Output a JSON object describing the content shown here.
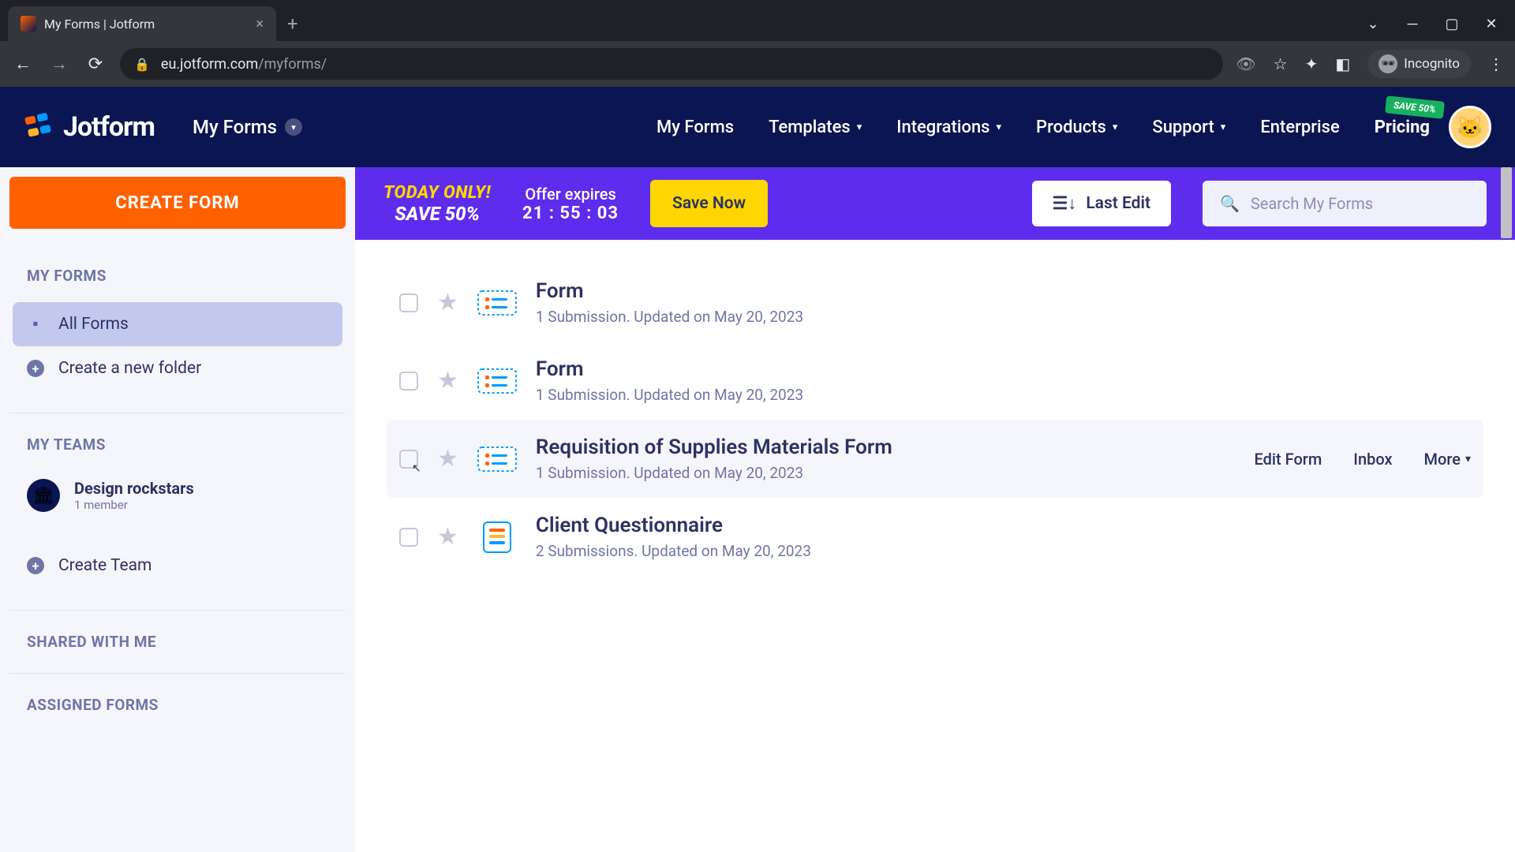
{
  "browser": {
    "tab_title": "My Forms | Jotform",
    "url_host": "eu.jotform.com",
    "url_path": "/myforms/",
    "incognito_label": "Incognito"
  },
  "header": {
    "logo_text": "Jotform",
    "dropdown_label": "My Forms",
    "nav": [
      {
        "label": "My Forms",
        "has_chev": false
      },
      {
        "label": "Templates",
        "has_chev": true
      },
      {
        "label": "Integrations",
        "has_chev": true
      },
      {
        "label": "Products",
        "has_chev": true
      },
      {
        "label": "Support",
        "has_chev": true
      },
      {
        "label": "Enterprise",
        "has_chev": false
      }
    ],
    "pricing_label": "Pricing",
    "pricing_badge": "SAVE 50%"
  },
  "sidebar": {
    "create_label": "CREATE FORM",
    "sections": {
      "my_forms_heading": "MY FORMS",
      "all_forms_label": "All Forms",
      "create_folder_label": "Create a new folder",
      "my_teams_heading": "MY TEAMS",
      "team_name": "Design rockstars",
      "team_members": "1 member",
      "create_team_label": "Create Team",
      "shared_heading": "SHARED WITH ME",
      "assigned_heading": "ASSIGNED FORMS"
    }
  },
  "promo": {
    "line1": "TODAY ONLY!",
    "line2": "SAVE 50%",
    "offer_label": "Offer expires",
    "offer_time": "21 : 55 : 03",
    "save_now": "Save Now",
    "sort_label": "Last Edit",
    "search_placeholder": "Search My Forms"
  },
  "forms": [
    {
      "title": "Form",
      "meta": "1 Submission. Updated on May 20, 2023",
      "icon": "card",
      "hovered": false
    },
    {
      "title": "Form",
      "meta": "1 Submission. Updated on May 20, 2023",
      "icon": "card",
      "hovered": false
    },
    {
      "title": "Requisition of Supplies Materials Form",
      "meta": "1 Submission. Updated on May 20, 2023",
      "icon": "card",
      "hovered": true
    },
    {
      "title": "Client Questionnaire",
      "meta": "2 Submissions. Updated on May 20, 2023",
      "icon": "classic",
      "hovered": false
    }
  ],
  "row_actions": {
    "edit": "Edit Form",
    "inbox": "Inbox",
    "more": "More"
  }
}
